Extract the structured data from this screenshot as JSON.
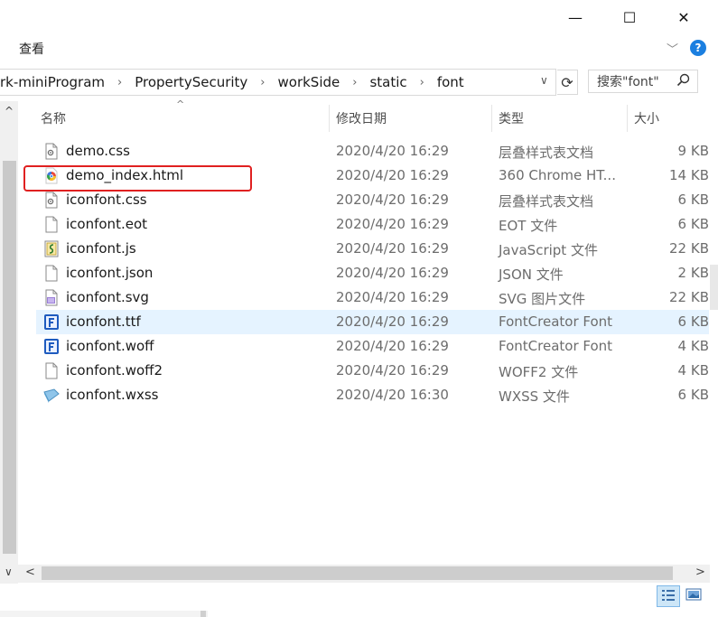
{
  "window": {
    "minimize_glyph": "—",
    "maximize_glyph": "☐",
    "close_glyph": "✕"
  },
  "ribbon": {
    "tab_view": "查看",
    "expand_glyph": "﹀",
    "help_glyph": "?"
  },
  "address": {
    "crumbs": [
      "rk-miniProgram",
      "PropertySecurity",
      "workSide",
      "static",
      "font"
    ],
    "separator": "›",
    "dropdown_glyph": "∨",
    "refresh_glyph": "⟳"
  },
  "search": {
    "placeholder": "搜索\"font\"",
    "icon": "search-icon"
  },
  "columns": {
    "name": "名称",
    "date": "修改日期",
    "type": "类型",
    "size": "大小",
    "sort_glyph": "^"
  },
  "files": [
    {
      "name": "demo.css",
      "date": "2020/4/20 16:29",
      "type": "层叠样式表文档",
      "size": "9 KB",
      "icon": "css-file-icon"
    },
    {
      "name": "demo_index.html",
      "date": "2020/4/20 16:29",
      "type": "360 Chrome HT...",
      "size": "14 KB",
      "icon": "chrome-html-icon"
    },
    {
      "name": "iconfont.css",
      "date": "2020/4/20 16:29",
      "type": "层叠样式表文档",
      "size": "6 KB",
      "icon": "css-file-icon"
    },
    {
      "name": "iconfont.eot",
      "date": "2020/4/20 16:29",
      "type": "EOT 文件",
      "size": "6 KB",
      "icon": "blank-file-icon"
    },
    {
      "name": "iconfont.js",
      "date": "2020/4/20 16:29",
      "type": "JavaScript 文件",
      "size": "22 KB",
      "icon": "script-file-icon"
    },
    {
      "name": "iconfont.json",
      "date": "2020/4/20 16:29",
      "type": "JSON 文件",
      "size": "2 KB",
      "icon": "blank-file-icon"
    },
    {
      "name": "iconfont.svg",
      "date": "2020/4/20 16:29",
      "type": "SVG 图片文件",
      "size": "22 KB",
      "icon": "svg-file-icon"
    },
    {
      "name": "iconfont.ttf",
      "date": "2020/4/20 16:29",
      "type": "FontCreator Font",
      "size": "6 KB",
      "icon": "fontcreator-icon",
      "selected": true
    },
    {
      "name": "iconfont.woff",
      "date": "2020/4/20 16:29",
      "type": "FontCreator Font",
      "size": "4 KB",
      "icon": "fontcreator-icon"
    },
    {
      "name": "iconfont.woff2",
      "date": "2020/4/20 16:29",
      "type": "WOFF2 文件",
      "size": "4 KB",
      "icon": "blank-file-icon"
    },
    {
      "name": "iconfont.wxss",
      "date": "2020/4/20 16:30",
      "type": "WXSS 文件",
      "size": "6 KB",
      "icon": "wxss-file-icon"
    }
  ],
  "scroll": {
    "up_glyph": "^",
    "down_glyph": "∨",
    "left_glyph": "<",
    "right_glyph": ">"
  },
  "colors": {
    "selection": "#e5f3ff",
    "highlight_border": "#e02020",
    "help_blue": "#1b7fe0"
  }
}
